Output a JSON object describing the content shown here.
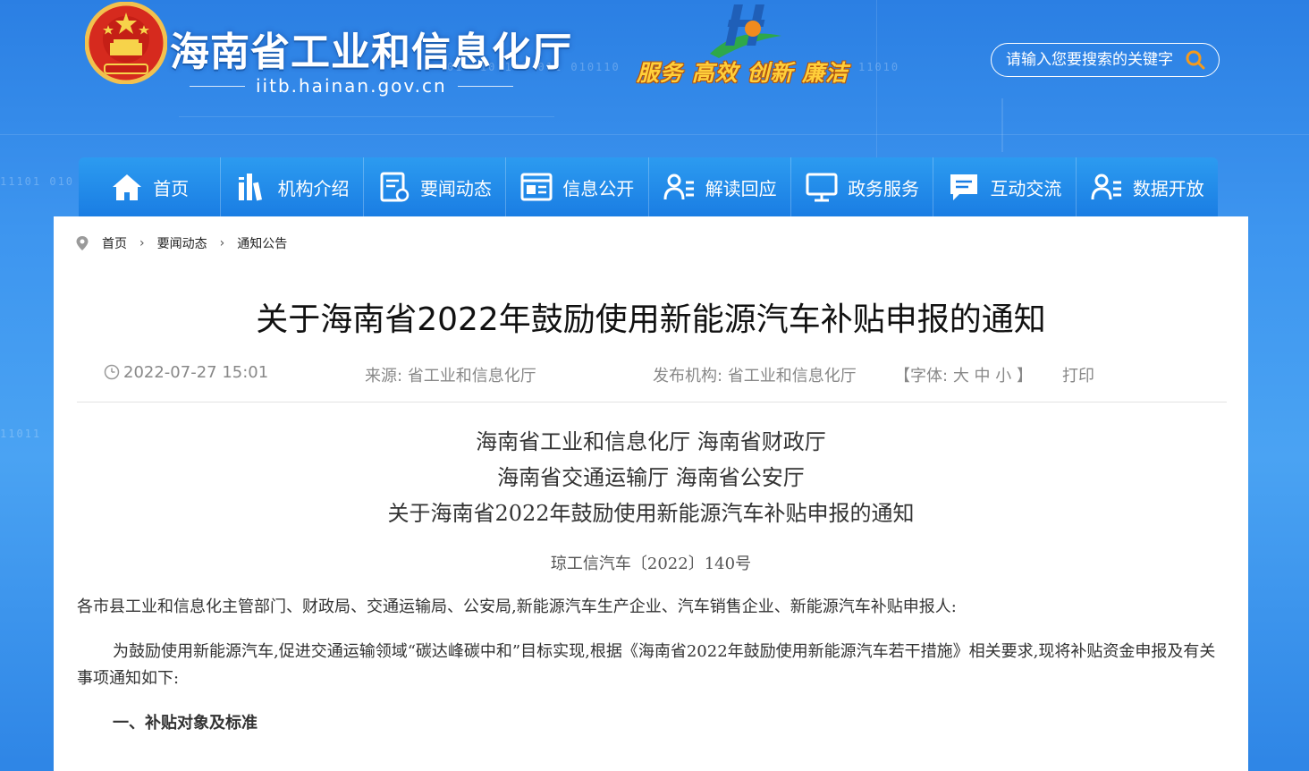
{
  "site": {
    "title": "海南省工业和信息化厅",
    "domain": "iitb.hainan.gov.cn",
    "slogan": "服务 高效 创新 廉洁"
  },
  "search": {
    "placeholder": "请输入您要搜索的关键字"
  },
  "nav": [
    {
      "label": "首页",
      "icon": "home-icon"
    },
    {
      "label": "机构介绍",
      "icon": "org-icon"
    },
    {
      "label": "要闻动态",
      "icon": "news-icon"
    },
    {
      "label": "信息公开",
      "icon": "info-icon"
    },
    {
      "label": "解读回应",
      "icon": "user-list-icon"
    },
    {
      "label": "政务服务",
      "icon": "monitor-icon"
    },
    {
      "label": "互动交流",
      "icon": "chat-icon"
    },
    {
      "label": "数据开放",
      "icon": "user-list-icon"
    }
  ],
  "breadcrumb": {
    "home": "首页",
    "section": "要闻动态",
    "current": "通知公告"
  },
  "article": {
    "title": "关于海南省2022年鼓励使用新能源汽车补贴申报的通知",
    "date": "2022-07-27 15:01",
    "source_label": "来源:",
    "source": "省工业和信息化厅",
    "publisher_label": "发布机构:",
    "publisher": "省工业和信息化厅",
    "font_label": "【字体:",
    "font_large": "大",
    "font_medium": "中",
    "font_small": "小",
    "font_close": "】",
    "print": "打印",
    "heading_line1": "海南省工业和信息化厅 海南省财政厅",
    "heading_line2": "海南省交通运输厅 海南省公安厅",
    "heading_line3": "关于海南省2022年鼓励使用新能源汽车补贴申报的通知",
    "doc_number": "琼工信汽车〔2022〕140号",
    "para1": "各市县工业和信息化主管部门、财政局、交通运输局、公安局,新能源汽车生产企业、汽车销售企业、新能源汽车补贴申报人:",
    "para2": "为鼓励使用新能源汽车,促进交通运输领域“碳达峰碳中和”目标实现,根据《海南省2022年鼓励使用新能源汽车若干措施》相关要求,现将补贴资金申报及有关事项通知如下:",
    "section1": "一、补贴对象及标准"
  }
}
